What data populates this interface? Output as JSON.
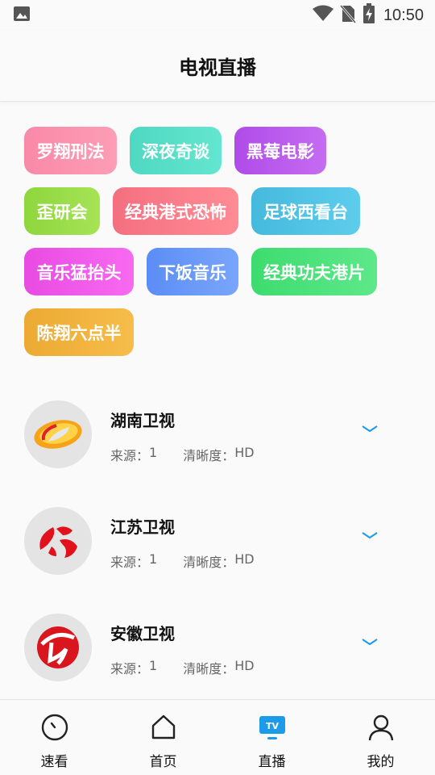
{
  "status_bar": {
    "time": "10:50"
  },
  "header": {
    "title": "电视直播"
  },
  "tags": [
    {
      "label": "罗翔刑法",
      "color_from": "#f989a8",
      "color_to": "#fd9db6"
    },
    {
      "label": "深夜奇谈",
      "color_from": "#4fd8c2",
      "color_to": "#63e6cf"
    },
    {
      "label": "黑莓电影",
      "color_from": "#b04be8",
      "color_to": "#c56cf2"
    },
    {
      "label": "歪研会",
      "color_from": "#8ed63e",
      "color_to": "#a6e355"
    },
    {
      "label": "经典港式恐怖",
      "color_from": "#f46f80",
      "color_to": "#ff8c95"
    },
    {
      "label": "足球西看台",
      "color_from": "#45b9dd",
      "color_to": "#5ecdec"
    },
    {
      "label": "音乐猛抬头",
      "color_from": "#e84be2",
      "color_to": "#f86af1"
    },
    {
      "label": "下饭音乐",
      "color_from": "#5b8df5",
      "color_to": "#79a6fb"
    },
    {
      "label": "经典功夫港片",
      "color_from": "#3ddc6f",
      "color_to": "#5ee88a"
    },
    {
      "label": "陈翔六点半",
      "color_from": "#ecaa33",
      "color_to": "#f6bd4a"
    }
  ],
  "channels": [
    {
      "name": "湖南卫视",
      "source_label": "来源：",
      "source_value": "1",
      "quality_label": "清晰度：",
      "quality_value": "HD",
      "logo": "hunan-tv-logo-icon"
    },
    {
      "name": "江苏卫视",
      "source_label": "来源：",
      "source_value": "1",
      "quality_label": "清晰度：",
      "quality_value": "HD",
      "logo": "jiangsu-tv-logo-icon"
    },
    {
      "name": "安徽卫视",
      "source_label": "来源：",
      "source_value": "1",
      "quality_label": "清晰度：",
      "quality_value": "HD",
      "logo": "anhui-tv-logo-icon"
    }
  ],
  "bottom_nav": [
    {
      "label": "速看",
      "icon": "clock-icon",
      "active": false
    },
    {
      "label": "首页",
      "icon": "home-icon",
      "active": false
    },
    {
      "label": "直播",
      "icon": "tv-icon",
      "active": true
    },
    {
      "label": "我的",
      "icon": "user-icon",
      "active": false
    }
  ],
  "colors": {
    "accent": "#1e9be8",
    "background": "#fafafa",
    "text": "#111111",
    "meta_text": "#666666"
  }
}
